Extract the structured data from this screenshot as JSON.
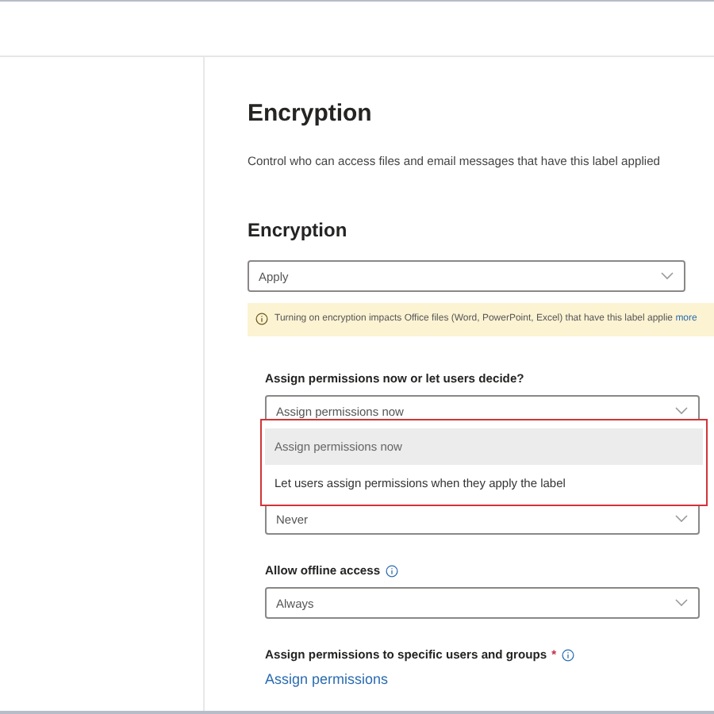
{
  "page": {
    "title": "Encryption",
    "description": "Control who can access files and email messages that have this label applied"
  },
  "encryption": {
    "heading": "Encryption",
    "value": "Apply"
  },
  "warning": {
    "text": "Turning on encryption impacts Office files (Word, PowerPoint, Excel) that have this label applie",
    "link": "more"
  },
  "assign_mode": {
    "label": "Assign permissions now or let users decide?",
    "value": "Assign permissions now",
    "expanded": true,
    "options": [
      {
        "label": "Assign permissions now",
        "selected": true
      },
      {
        "label": "Let users assign permissions when they apply the label",
        "selected": false
      }
    ]
  },
  "expiry": {
    "value": "Never"
  },
  "offline_access": {
    "label": "Allow offline access",
    "value": "Always"
  },
  "assign_users": {
    "label": "Assign permissions to specific users and groups",
    "required_mark": "*",
    "link": "Assign permissions"
  }
}
